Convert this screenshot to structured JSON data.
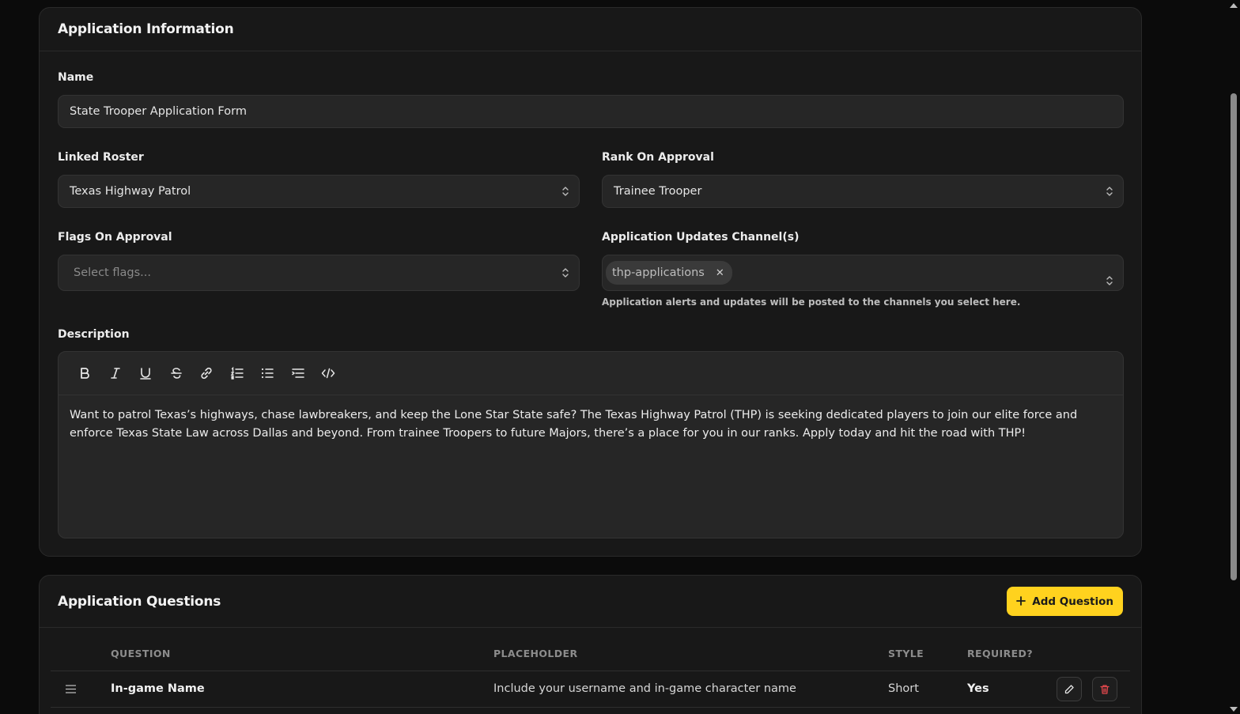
{
  "application_info": {
    "title": "Application Information",
    "name_label": "Name",
    "name_value": "State Trooper Application Form",
    "linked_roster_label": "Linked Roster",
    "linked_roster_value": "Texas Highway Patrol",
    "rank_label": "Rank On Approval",
    "rank_value": "Trainee Trooper",
    "flags_label": "Flags On Approval",
    "flags_placeholder": "Select flags...",
    "channels_label": "Application Updates Channel(s)",
    "channels_selected": [
      "thp-applications"
    ],
    "channels_remove_glyph": "✕",
    "channels_helper": "Application alerts and updates will be posted to the channels you select here.",
    "description_label": "Description",
    "description_text": "Want to patrol Texas’s highways, chase lawbreakers, and keep the Lone Star State safe? The Texas Highway Patrol (THP) is seeking dedicated players to join our elite force and enforce Texas State Law across Dallas and beyond. From trainee Troopers to future Majors, there’s a place for you in our ranks. Apply today and hit the road with THP!",
    "toolbar_icons": [
      "bold-icon",
      "italic-icon",
      "underline-icon",
      "strikethrough-icon",
      "link-icon",
      "ordered-list-icon",
      "bullet-list-icon",
      "indent-icon",
      "code-icon"
    ]
  },
  "questions": {
    "title": "Application Questions",
    "add_button_label": "Add Question",
    "columns": [
      "QUESTION",
      "PLACEHOLDER",
      "STYLE",
      "REQUIRED?"
    ],
    "rows": [
      {
        "question": "In-game Name",
        "placeholder": "Include your username and in-game character name",
        "style": "Short",
        "required": "Yes"
      }
    ]
  },
  "colors": {
    "accent": "#ffd21e",
    "background": "#0b0b0b",
    "card": "#181818",
    "input": "#262626",
    "danger": "#e5484d"
  }
}
